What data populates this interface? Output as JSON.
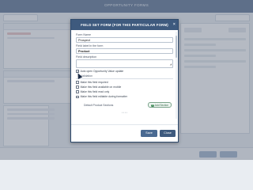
{
  "background": {
    "top_title": "OPPORTUNITY FORMS"
  },
  "modal": {
    "title": "FIELD SET FORM (FOR THIS PARTICULAR FORM)",
    "fields": [
      {
        "label": "Form Name",
        "value": "Prospect"
      },
      {
        "label": "Field label in the form",
        "value": "Product"
      },
      {
        "label": "Field description",
        "value": ""
      }
    ],
    "checkboxes": [
      {
        "label": "Auto open Opportunity Value update",
        "checked": true
      }
    ],
    "validation_heading": "Validation",
    "validation_options": [
      {
        "label": "Make this field required",
        "checked": false
      },
      {
        "label": "Make this field available on mobile",
        "checked": false
      },
      {
        "label": "Make this field read only",
        "checked": false
      },
      {
        "label": "Make this field editable during formatter",
        "checked": false
      }
    ],
    "default_section_label": "Default Product Sections",
    "add_button_label": "Add Section",
    "cancel_label": "Save",
    "close_label": "Close"
  },
  "colors": {
    "header": "#3e5a7e",
    "accent_green": "#48905f"
  }
}
